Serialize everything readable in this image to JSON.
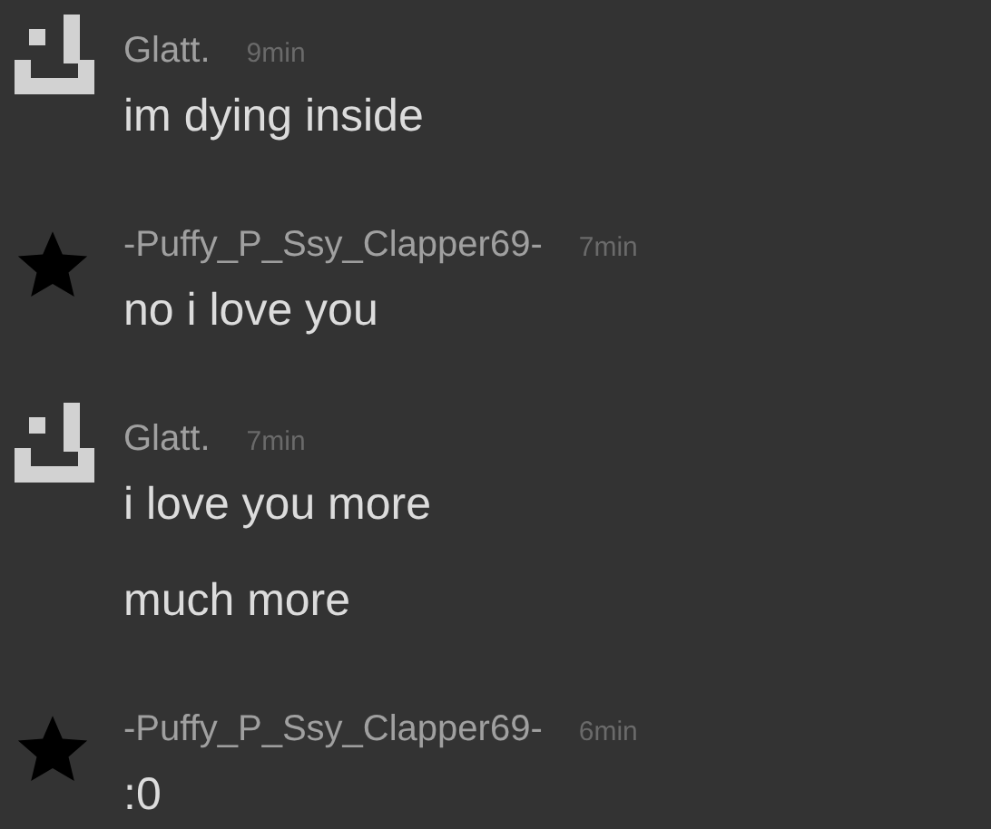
{
  "messages": [
    {
      "author": "Glatt.",
      "time": "9min",
      "avatar": {
        "kind": "pixel-face"
      },
      "lines": [
        "im dying inside"
      ]
    },
    {
      "author": "-Puffy_P_Ssy_Clapper69-",
      "time": "7min",
      "avatar": {
        "kind": "star"
      },
      "lines": [
        "no i love you"
      ]
    },
    {
      "author": "Glatt.",
      "time": "7min",
      "avatar": {
        "kind": "pixel-face"
      },
      "lines": [
        "i love you more",
        "much more"
      ]
    },
    {
      "author": "-Puffy_P_Ssy_Clapper69-",
      "time": "6min",
      "avatar": {
        "kind": "star"
      },
      "lines": [
        ":0"
      ]
    }
  ]
}
